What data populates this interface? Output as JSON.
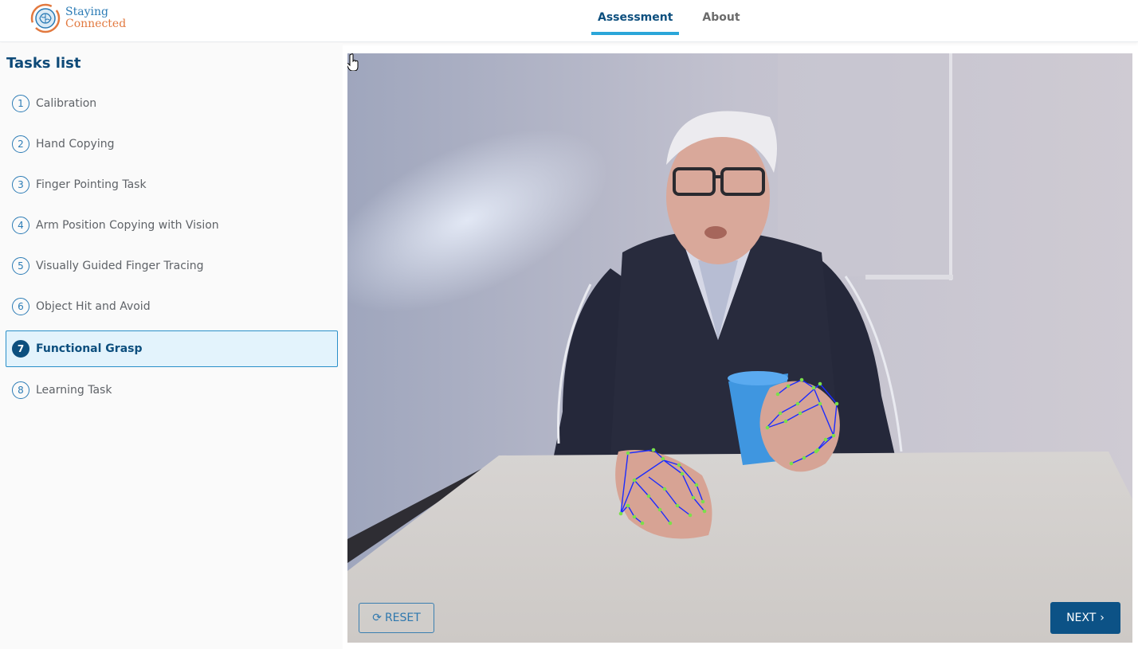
{
  "brand": {
    "line1": "Staying",
    "line2": "Connected"
  },
  "nav": {
    "tabs": [
      {
        "label": "Assessment",
        "active": true
      },
      {
        "label": "About",
        "active": false
      }
    ]
  },
  "sidebar": {
    "title": "Tasks list",
    "tasks": [
      {
        "num": "1",
        "label": "Calibration"
      },
      {
        "num": "2",
        "label": "Hand Copying"
      },
      {
        "num": "3",
        "label": "Finger Pointing Task"
      },
      {
        "num": "4",
        "label": "Arm Position Copying with Vision"
      },
      {
        "num": "5",
        "label": "Visually Guided Finger Tracing"
      },
      {
        "num": "6",
        "label": "Object Hit and Avoid"
      },
      {
        "num": "7",
        "label": "Functional Grasp",
        "active": true
      },
      {
        "num": "8",
        "label": "Learning Task"
      }
    ]
  },
  "video": {
    "reset_label": "RESET",
    "reset_icon": "refresh-icon",
    "next_label": "NEXT",
    "next_icon": "chevron-right-icon"
  },
  "colors": {
    "accent": "#0d4f7e",
    "highlight": "#2aa6d9",
    "active_bg": "#e3f3fc",
    "brand_blue": "#2b7bb5",
    "brand_orange": "#e2793f"
  }
}
